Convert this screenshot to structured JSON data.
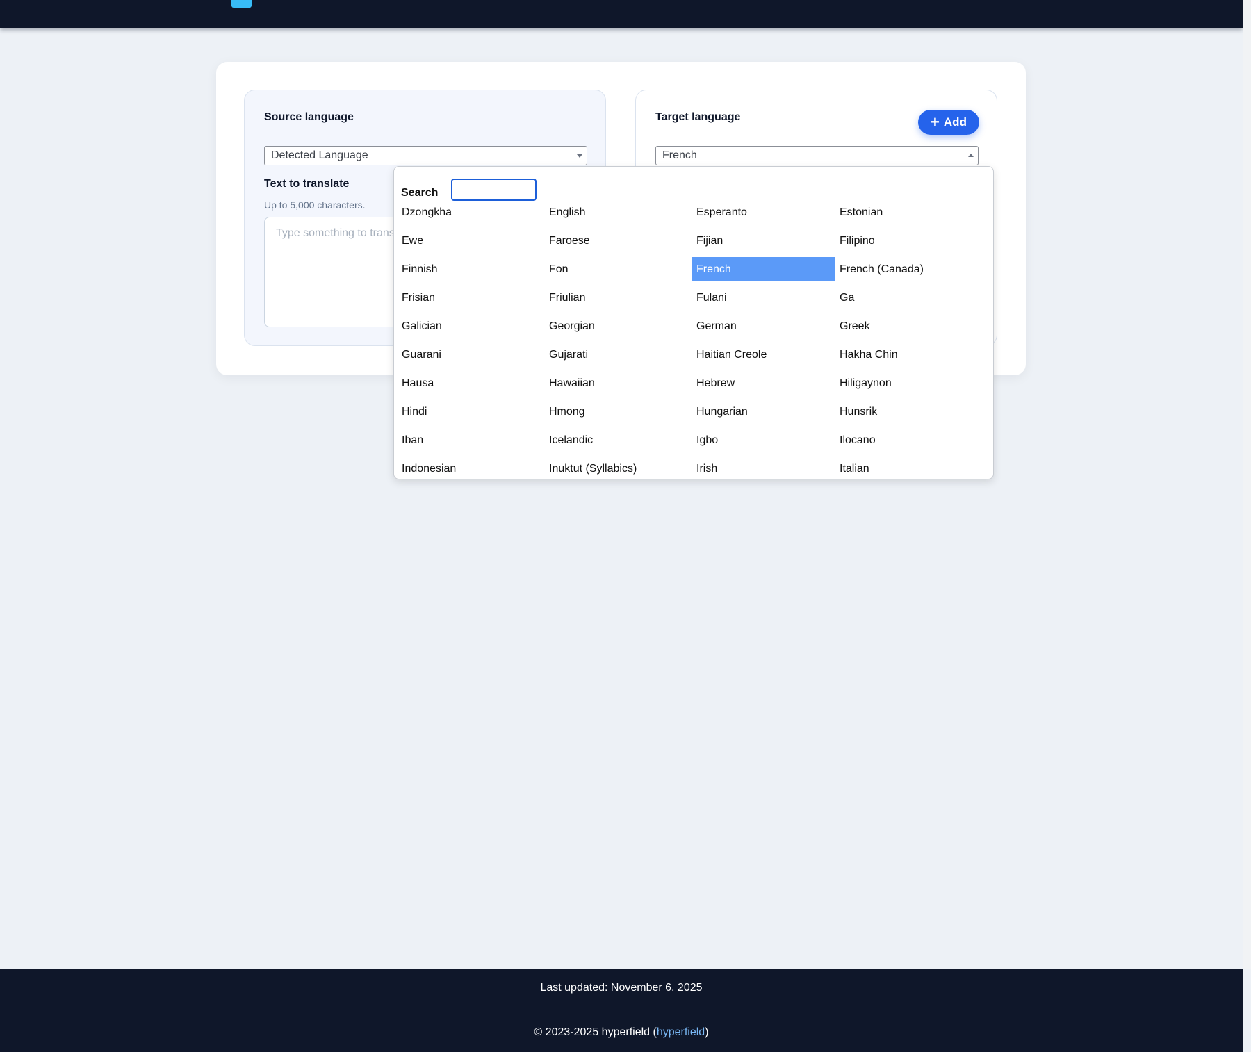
{
  "header": {
    "title": ""
  },
  "source": {
    "title": "Source language",
    "selected": "Detected Language",
    "field_label": "Text to translate",
    "hint": "Up to 5,000 characters.",
    "placeholder": "Type something to translate"
  },
  "target": {
    "title": "Target language",
    "add_label": "Add",
    "selected": "French"
  },
  "dropdown": {
    "search_label": "Search",
    "search_value": "",
    "options": [
      "Dzongkha",
      "English",
      "Esperanto",
      "Estonian",
      "Ewe",
      "Faroese",
      "Fijian",
      "Filipino",
      "Finnish",
      "Fon",
      "French",
      "French (Canada)",
      "Frisian",
      "Friulian",
      "Fulani",
      "Ga",
      "Galician",
      "Georgian",
      "German",
      "Greek",
      "Guarani",
      "Gujarati",
      "Haitian Creole",
      "Hakha Chin",
      "Hausa",
      "Hawaiian",
      "Hebrew",
      "Hiligaynon",
      "Hindi",
      "Hmong",
      "Hungarian",
      "Hunsrik",
      "Iban",
      "Icelandic",
      "Igbo",
      "Ilocano",
      "Indonesian",
      "Inuktut (Syllabics)",
      "Irish",
      "Italian"
    ],
    "selected_index": 10
  },
  "footer": {
    "updated": "Last updated: November 6, 2025",
    "copy_prefix": "© 2023-2025 hyperfield (",
    "link_text": "hyperfield",
    "copy_suffix": ")"
  },
  "colors": {
    "accent": "#2563eb",
    "selected_option": "#5b9af8",
    "header_bg": "#0f172a",
    "page_bg": "#edf1f6"
  }
}
